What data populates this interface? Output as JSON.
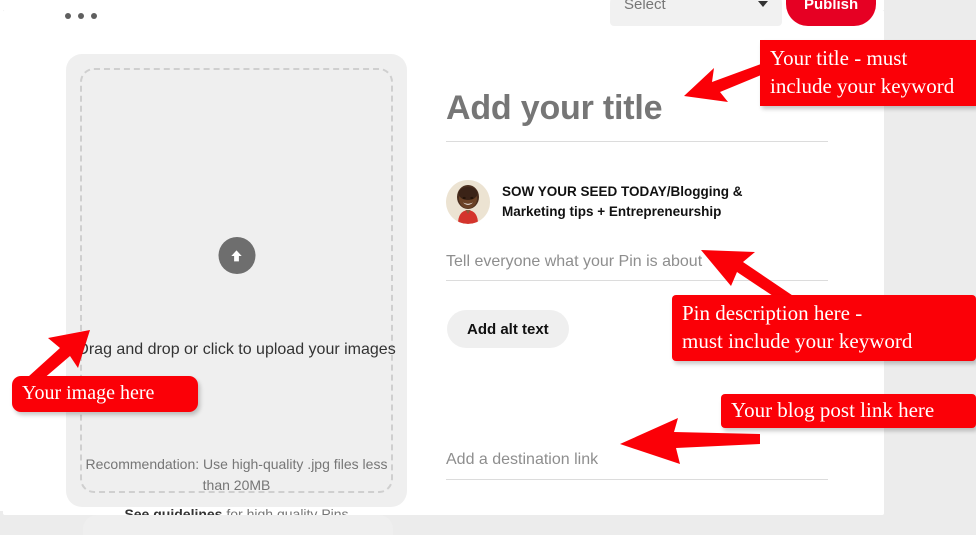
{
  "window": {
    "page_background": "#ececec",
    "card_background": "#ffffff",
    "brand_red": "#e60023",
    "annotation_red": "#fb0007"
  },
  "top_bar": {
    "overflow_menu_label": "...",
    "board_select": {
      "value": "Select",
      "caret_icon": "chevron-down-icon"
    },
    "publish_label": "Publish"
  },
  "upload": {
    "icon": "upload-arrow-icon",
    "primary_text": "Drag and drop or click to\nupload your images",
    "recommendation_text": "Recommendation: Use high-quality .jpg files less than 20MB",
    "guidelines_link": "See guidelines",
    "guidelines_rest": " for high quality Pins"
  },
  "form": {
    "title_placeholder": "Add your title",
    "account_name": "SOW YOUR SEED TODAY/Blogging & Marketing tips + Entrepreneurship",
    "avatar_alt": "profile-avatar",
    "description_placeholder": "Tell everyone what your Pin is about",
    "alt_text_button": "Add alt text",
    "destination_link_placeholder": "Add a destination link"
  },
  "annotations": [
    {
      "id": "title",
      "text": "Your title - must\ninclude your keyword",
      "arrow": "arrow-pointing-left-down"
    },
    {
      "id": "description",
      "text": "Pin description here -\nmust include your keyword",
      "arrow": "arrow-pointing-up-left"
    },
    {
      "id": "image",
      "text": "Your image here",
      "arrow": "arrow-pointing-up-right"
    },
    {
      "id": "blog",
      "text": "Your blog post link here",
      "arrow": "arrow-pointing-left"
    }
  ]
}
